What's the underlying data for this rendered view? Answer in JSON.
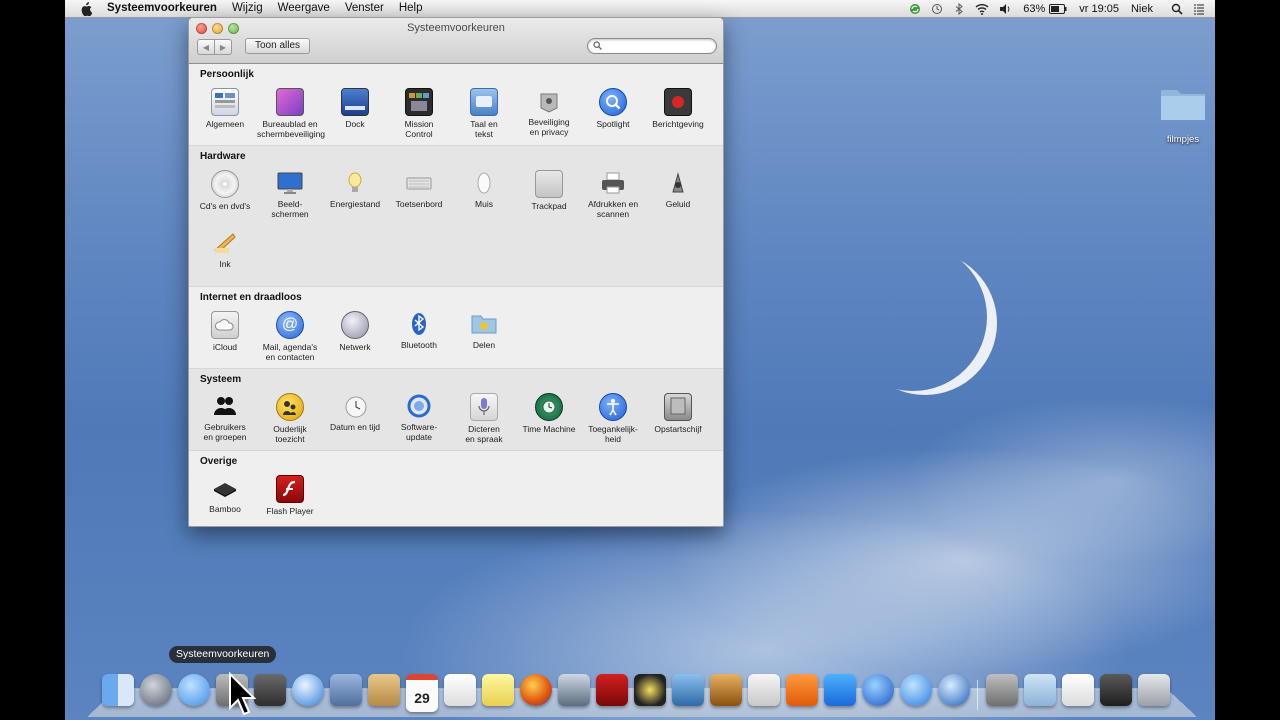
{
  "menubar": {
    "app_name": "Systeemvoorkeuren",
    "items": [
      "Wijzig",
      "Weergave",
      "Venster",
      "Help"
    ],
    "battery": "63%",
    "clock": "vr 19:05",
    "user": "Niek"
  },
  "window": {
    "title": "Systeemvoorkeuren",
    "show_all": "Toon alles",
    "search_placeholder": "",
    "sections": [
      {
        "title": "Persoonlijk",
        "items": [
          {
            "label": "Algemeen",
            "icon": "general-icon"
          },
          {
            "label": "Bureaublad en\nschermbeveiliging",
            "icon": "desktop-screensaver-icon"
          },
          {
            "label": "Dock",
            "icon": "dock-icon"
          },
          {
            "label": "Mission\nControl",
            "icon": "mission-control-icon"
          },
          {
            "label": "Taal en\ntekst",
            "icon": "language-icon"
          },
          {
            "label": "Beveiliging\nen privacy",
            "icon": "security-icon"
          },
          {
            "label": "Spotlight",
            "icon": "spotlight-icon"
          },
          {
            "label": "Berichtgeving",
            "icon": "notifications-icon"
          }
        ]
      },
      {
        "title": "Hardware",
        "items": [
          {
            "label": "Cd's en dvd's",
            "icon": "cd-dvd-icon"
          },
          {
            "label": "Beeld-\nschermen",
            "icon": "displays-icon"
          },
          {
            "label": "Energiestand",
            "icon": "energy-icon"
          },
          {
            "label": "Toetsenbord",
            "icon": "keyboard-icon"
          },
          {
            "label": "Muis",
            "icon": "mouse-icon"
          },
          {
            "label": "Trackpad",
            "icon": "trackpad-icon"
          },
          {
            "label": "Afdrukken en\nscannen",
            "icon": "printer-icon"
          },
          {
            "label": "Geluid",
            "icon": "sound-icon"
          },
          {
            "label": "Ink",
            "icon": "ink-icon"
          }
        ]
      },
      {
        "title": "Internet en draadloos",
        "items": [
          {
            "label": "iCloud",
            "icon": "icloud-icon"
          },
          {
            "label": "Mail, agenda's\nen contacten",
            "icon": "mail-icon"
          },
          {
            "label": "Netwerk",
            "icon": "network-icon"
          },
          {
            "label": "Bluetooth",
            "icon": "bluetooth-icon"
          },
          {
            "label": "Delen",
            "icon": "sharing-icon"
          }
        ]
      },
      {
        "title": "Systeem",
        "items": [
          {
            "label": "Gebruikers\nen groepen",
            "icon": "users-icon"
          },
          {
            "label": "Ouderlijk\ntoezicht",
            "icon": "parental-icon"
          },
          {
            "label": "Datum en tijd",
            "icon": "date-time-icon"
          },
          {
            "label": "Software-\nupdate",
            "icon": "software-update-icon"
          },
          {
            "label": "Dicteren\nen spraak",
            "icon": "dictation-icon"
          },
          {
            "label": "Time Machine",
            "icon": "time-machine-icon"
          },
          {
            "label": "Toegankelijk-\nheid",
            "icon": "accessibility-icon"
          },
          {
            "label": "Opstartschijf",
            "icon": "startup-disk-icon"
          }
        ]
      },
      {
        "title": "Overige",
        "items": [
          {
            "label": "Bamboo",
            "icon": "bamboo-icon"
          },
          {
            "label": "Flash Player",
            "icon": "flash-icon"
          }
        ]
      }
    ]
  },
  "desktop": {
    "folder_label": "filmpjes"
  },
  "dock": {
    "tooltip": "Systeemvoorkeuren",
    "calendar_day": "29",
    "apps": [
      "finder-icon",
      "launchpad-icon",
      "messages-icon",
      "system-preferences-icon",
      "photo-booth-icon",
      "safari-icon",
      "preview-icon",
      "contacts-icon",
      "calendar-icon",
      "reminders-icon",
      "notes-icon",
      "firefox-icon",
      "facetime-icon",
      "photo-app-icon",
      "imovie-icon",
      "iphoto-icon",
      "garageband-icon",
      "keynote-icon",
      "pages-icon",
      "word-icon",
      "itunes-icon",
      "app-store-icon",
      "quicktime-icon",
      "folder-photos-icon",
      "folder-icon",
      "document-icon",
      "display-icon",
      "trash-icon"
    ]
  }
}
